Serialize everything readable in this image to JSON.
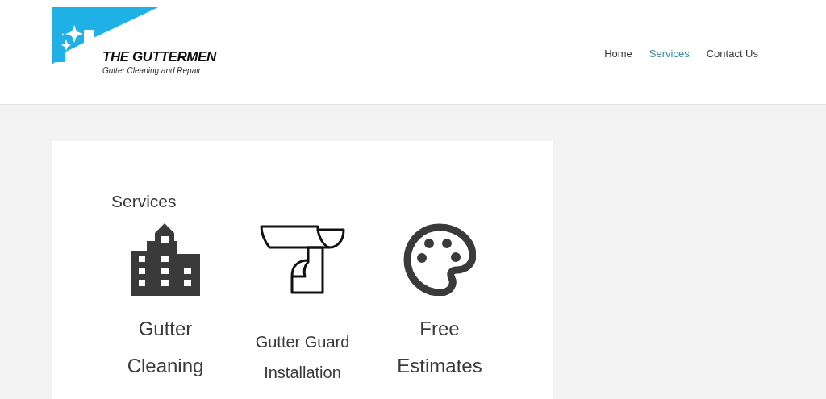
{
  "logo": {
    "name": "THE GUTTERMEN",
    "tagline": "Gutter Cleaning and Repair"
  },
  "nav": [
    {
      "label": "Home",
      "selected": false
    },
    {
      "label": "Services",
      "selected": true
    },
    {
      "label": "Contact Us",
      "selected": false
    }
  ],
  "section": {
    "title": "Services",
    "items": [
      {
        "kind": "building",
        "label": "Gutter Cleaning"
      },
      {
        "kind": "gutter",
        "label": "Gutter Guard Installation"
      },
      {
        "kind": "palette",
        "label": "Free Estimates"
      }
    ]
  }
}
